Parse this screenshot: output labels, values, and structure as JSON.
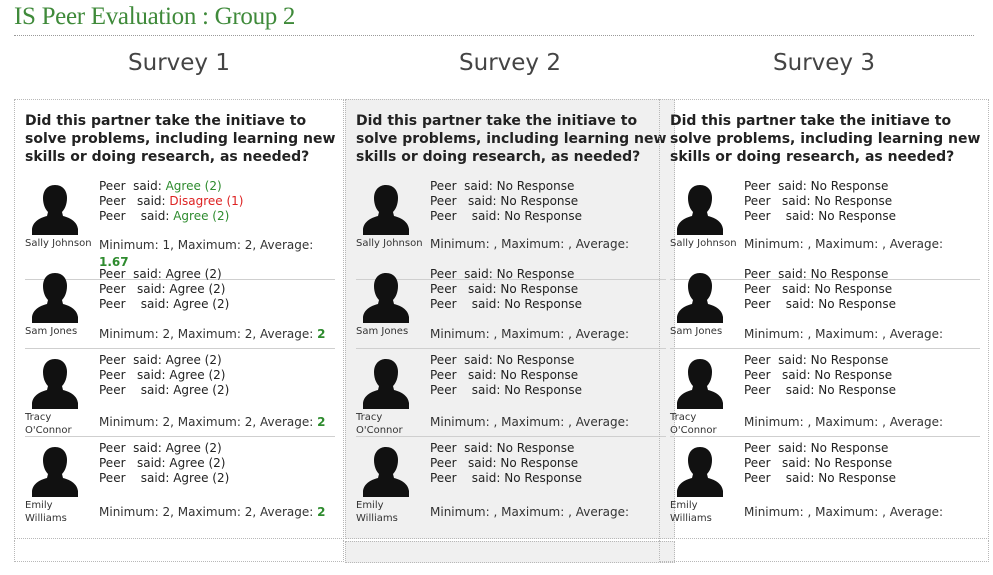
{
  "page_title": "IS Peer Evaluation : Group 2",
  "question": "Did this partner take the initiave to solve problems, including learning new skills or doing research, as needed?",
  "surveys": [
    {
      "title": "Survey 1",
      "people": [
        {
          "name": "Sally Johnson",
          "responses": [
            {
              "peer": "Peer",
              "said": "said:",
              "value": "Agree (2)",
              "tone": "ok"
            },
            {
              "peer": "Peer",
              "said": "said:",
              "value": "Disagree (1)",
              "tone": "bad"
            },
            {
              "peer": "Peer",
              "said": "said:",
              "value": "Agree (2)",
              "tone": "ok"
            }
          ],
          "stats": "Minimum: 1, Maximum: 2, Average:",
          "avg": "1.67"
        },
        {
          "name": "Sam Jones",
          "responses": [
            {
              "peer": "Peer",
              "said": "said:",
              "value": "Agree (2)",
              "tone": "neu"
            },
            {
              "peer": "Peer",
              "said": "said:",
              "value": "Agree (2)",
              "tone": "neu"
            },
            {
              "peer": "Peer",
              "said": "said:",
              "value": "Agree (2)",
              "tone": "neu"
            }
          ],
          "stats": "Minimum: 2, Maximum: 2, Average:",
          "avg": "2"
        },
        {
          "name": "Tracy O'Connor",
          "responses": [
            {
              "peer": "Peer",
              "said": "said:",
              "value": "Agree (2)",
              "tone": "neu"
            },
            {
              "peer": "Peer",
              "said": "said:",
              "value": "Agree (2)",
              "tone": "neu"
            },
            {
              "peer": "Peer",
              "said": "said:",
              "value": "Agree (2)",
              "tone": "neu"
            }
          ],
          "stats": "Minimum: 2, Maximum: 2, Average:",
          "avg": "2"
        },
        {
          "name": "Emily Williams",
          "responses": [
            {
              "peer": "Peer",
              "said": "said:",
              "value": "Agree (2)",
              "tone": "neu"
            },
            {
              "peer": "Peer",
              "said": "said:",
              "value": "Agree (2)",
              "tone": "neu"
            },
            {
              "peer": "Peer",
              "said": "said:",
              "value": "Agree (2)",
              "tone": "neu"
            }
          ],
          "stats": "Minimum: 2, Maximum: 2, Average:",
          "avg": "2"
        }
      ]
    },
    {
      "title": "Survey 2",
      "people": [
        {
          "name": "Sally Johnson",
          "responses": [
            {
              "peer": "Peer",
              "said": "said:",
              "value": "No Response",
              "tone": "neu"
            },
            {
              "peer": "Peer",
              "said": "said:",
              "value": "No Response",
              "tone": "neu"
            },
            {
              "peer": "Peer",
              "said": "said:",
              "value": "No Response",
              "tone": "neu"
            }
          ],
          "stats": "Minimum: , Maximum: , Average:",
          "avg": ""
        },
        {
          "name": "Sam Jones",
          "responses": [
            {
              "peer": "Peer",
              "said": "said:",
              "value": "No Response",
              "tone": "neu"
            },
            {
              "peer": "Peer",
              "said": "said:",
              "value": "No Response",
              "tone": "neu"
            },
            {
              "peer": "Peer",
              "said": "said:",
              "value": "No Response",
              "tone": "neu"
            }
          ],
          "stats": "Minimum: , Maximum: , Average:",
          "avg": ""
        },
        {
          "name": "Tracy O'Connor",
          "responses": [
            {
              "peer": "Peer",
              "said": "said:",
              "value": "No Response",
              "tone": "neu"
            },
            {
              "peer": "Peer",
              "said": "said:",
              "value": "No Response",
              "tone": "neu"
            },
            {
              "peer": "Peer",
              "said": "said:",
              "value": "No Response",
              "tone": "neu"
            }
          ],
          "stats": "Minimum: , Maximum: , Average:",
          "avg": ""
        },
        {
          "name": "Emily Williams",
          "responses": [
            {
              "peer": "Peer",
              "said": "said:",
              "value": "No Response",
              "tone": "neu"
            },
            {
              "peer": "Peer",
              "said": "said:",
              "value": "No Response",
              "tone": "neu"
            },
            {
              "peer": "Peer",
              "said": "said:",
              "value": "No Response",
              "tone": "neu"
            }
          ],
          "stats": "Minimum: , Maximum: , Average:",
          "avg": ""
        }
      ]
    },
    {
      "title": "Survey 3",
      "people": [
        {
          "name": "Sally Johnson",
          "responses": [
            {
              "peer": "Peer",
              "said": "said:",
              "value": "No Response",
              "tone": "neu"
            },
            {
              "peer": "Peer",
              "said": "said:",
              "value": "No Response",
              "tone": "neu"
            },
            {
              "peer": "Peer",
              "said": "said:",
              "value": "No Response",
              "tone": "neu"
            }
          ],
          "stats": "Minimum: , Maximum: , Average:",
          "avg": ""
        },
        {
          "name": "Sam Jones",
          "responses": [
            {
              "peer": "Peer",
              "said": "said:",
              "value": "No Response",
              "tone": "neu"
            },
            {
              "peer": "Peer",
              "said": "said:",
              "value": "No Response",
              "tone": "neu"
            },
            {
              "peer": "Peer",
              "said": "said:",
              "value": "No Response",
              "tone": "neu"
            }
          ],
          "stats": "Minimum: , Maximum: , Average:",
          "avg": ""
        },
        {
          "name": "Tracy O'Connor",
          "responses": [
            {
              "peer": "Peer",
              "said": "said:",
              "value": "No Response",
              "tone": "neu"
            },
            {
              "peer": "Peer",
              "said": "said:",
              "value": "No Response",
              "tone": "neu"
            },
            {
              "peer": "Peer",
              "said": "said:",
              "value": "No Response",
              "tone": "neu"
            }
          ],
          "stats": "Minimum: , Maximum: , Average:",
          "avg": ""
        },
        {
          "name": "Emily Williams",
          "responses": [
            {
              "peer": "Peer",
              "said": "said:",
              "value": "No Response",
              "tone": "neu"
            },
            {
              "peer": "Peer",
              "said": "said:",
              "value": "No Response",
              "tone": "neu"
            },
            {
              "peer": "Peer",
              "said": "said:",
              "value": "No Response",
              "tone": "neu"
            }
          ],
          "stats": "Minimum: , Maximum: , Average:",
          "avg": ""
        }
      ]
    }
  ],
  "icons": {
    "avatar": "person-silhouette-icon"
  },
  "colors": {
    "title": "#3f8a3a",
    "agree": "#2e8b2e",
    "disagree": "#dd2222"
  }
}
